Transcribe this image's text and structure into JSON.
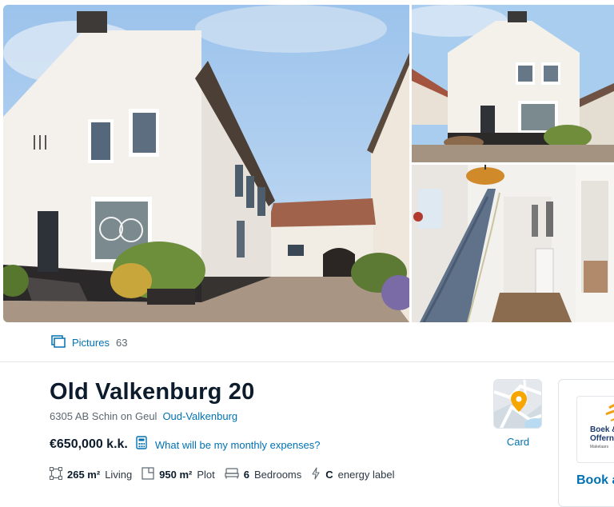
{
  "gallery": {
    "pictures_label": "Pictures",
    "pictures_count": "63"
  },
  "listing": {
    "title": "Old Valkenburg 20",
    "postal_city": "6305 AB Schin on Geul",
    "neighborhood": "Oud-Valkenburg",
    "price": "€650,000 k.k.",
    "expenses_link": "What will be my monthly expenses?",
    "map_label": "Card"
  },
  "features": {
    "living_value": "265 m²",
    "living_label": "Living",
    "plot_value": "950 m²",
    "plot_label": "Plot",
    "bedrooms_value": "6",
    "bedrooms_label": "Bedrooms",
    "energy_value": "C",
    "energy_label": "energy label"
  },
  "agent": {
    "logo_line1": "Boek &",
    "logo_line2": "Offern",
    "logo_line3": "Makelaars",
    "book_label": "Book a"
  },
  "colors": {
    "link": "#0071b3",
    "text": "#0c1c2c",
    "muted": "#5c6770",
    "map_pin": "#f7a600"
  }
}
